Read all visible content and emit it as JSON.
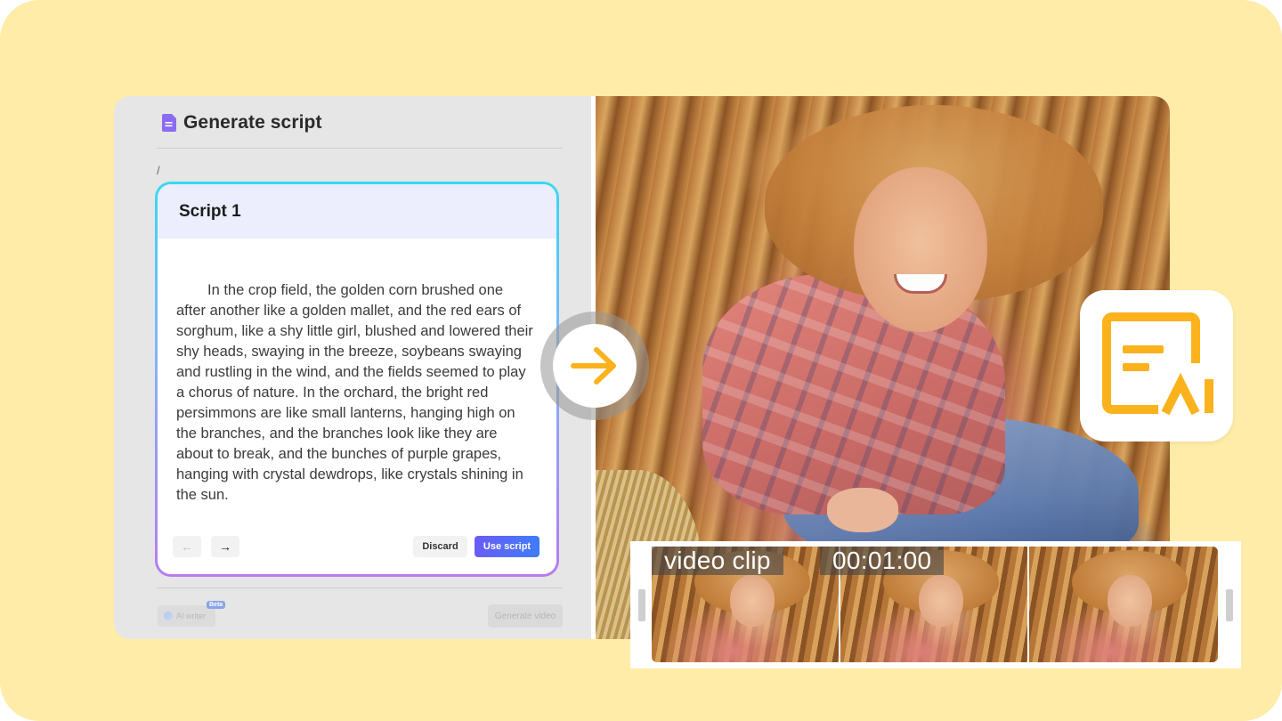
{
  "editor": {
    "title": "Generate script",
    "breadcrumb": "/",
    "script_card": {
      "heading": "Script 1",
      "body": "In the crop field, the golden corn brushed one after another like a golden mallet, and the red ears of sorghum, like a shy little girl, blushed and lowered their shy heads, swaying in the breeze, soybeans swaying and rustling in the wind, and the fields seemed to play a chorus of nature.   In the orchard, the bright red persimmons are like small lanterns, hanging high on the branches, and the branches look like they are about to break, and the bunches of purple grapes, hanging with crystal dewdrops, like crystals shining in the sun.",
      "prev_icon": "←",
      "next_icon": "→",
      "discard_label": "Discard",
      "use_label": "Use script"
    },
    "footer": {
      "ai_writer_label": "AI writer",
      "beta_badge": "Beta",
      "generate_label": "Generate video"
    }
  },
  "timeline": {
    "clip_label": "video clip",
    "timecode": "00:01:00",
    "frames": 3
  },
  "colors": {
    "background": "#ffeca8",
    "accent_orange": "#fbb21c",
    "primary_button": "#5b6cf7",
    "card_gradient_top": "#37d9f0",
    "card_gradient_bottom": "#b77cf0"
  },
  "icons": {
    "title_icon": "document-icon",
    "center": "arrow-right-icon",
    "badge": "ai-writer-logo-icon"
  }
}
